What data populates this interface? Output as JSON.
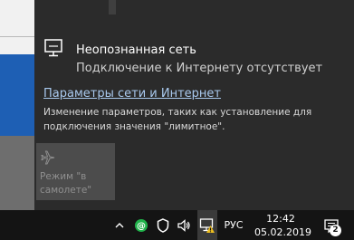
{
  "network": {
    "name": "Неопознанная сеть",
    "status": "Подключение к Интернету отсутствует",
    "icon": "ethernet-monitor-icon"
  },
  "settings": {
    "link_label": "Параметры сети и Интернет",
    "description": "Изменение параметров, таких как установление для подключения значения \"лимитное\"."
  },
  "quick_actions": {
    "airplane_mode": {
      "label": "Режим \"в самолете\"",
      "icon": "airplane-icon",
      "state": "off"
    }
  },
  "taskbar": {
    "tray_icons": [
      "chevron-up-icon",
      "green-at-icon",
      "shield-icon",
      "speaker-icon",
      "network-warning-icon"
    ],
    "language": "РУС",
    "time": "12:42",
    "date": "05.02.2019",
    "notification_count": "2"
  },
  "colors": {
    "flyout_bg": "#2b2b2b",
    "link": "#a9c9ee",
    "taskbar_bg": "#141414",
    "tile_bg": "#4c4c4c",
    "warning": "#f0c020",
    "green": "#20b24a"
  }
}
